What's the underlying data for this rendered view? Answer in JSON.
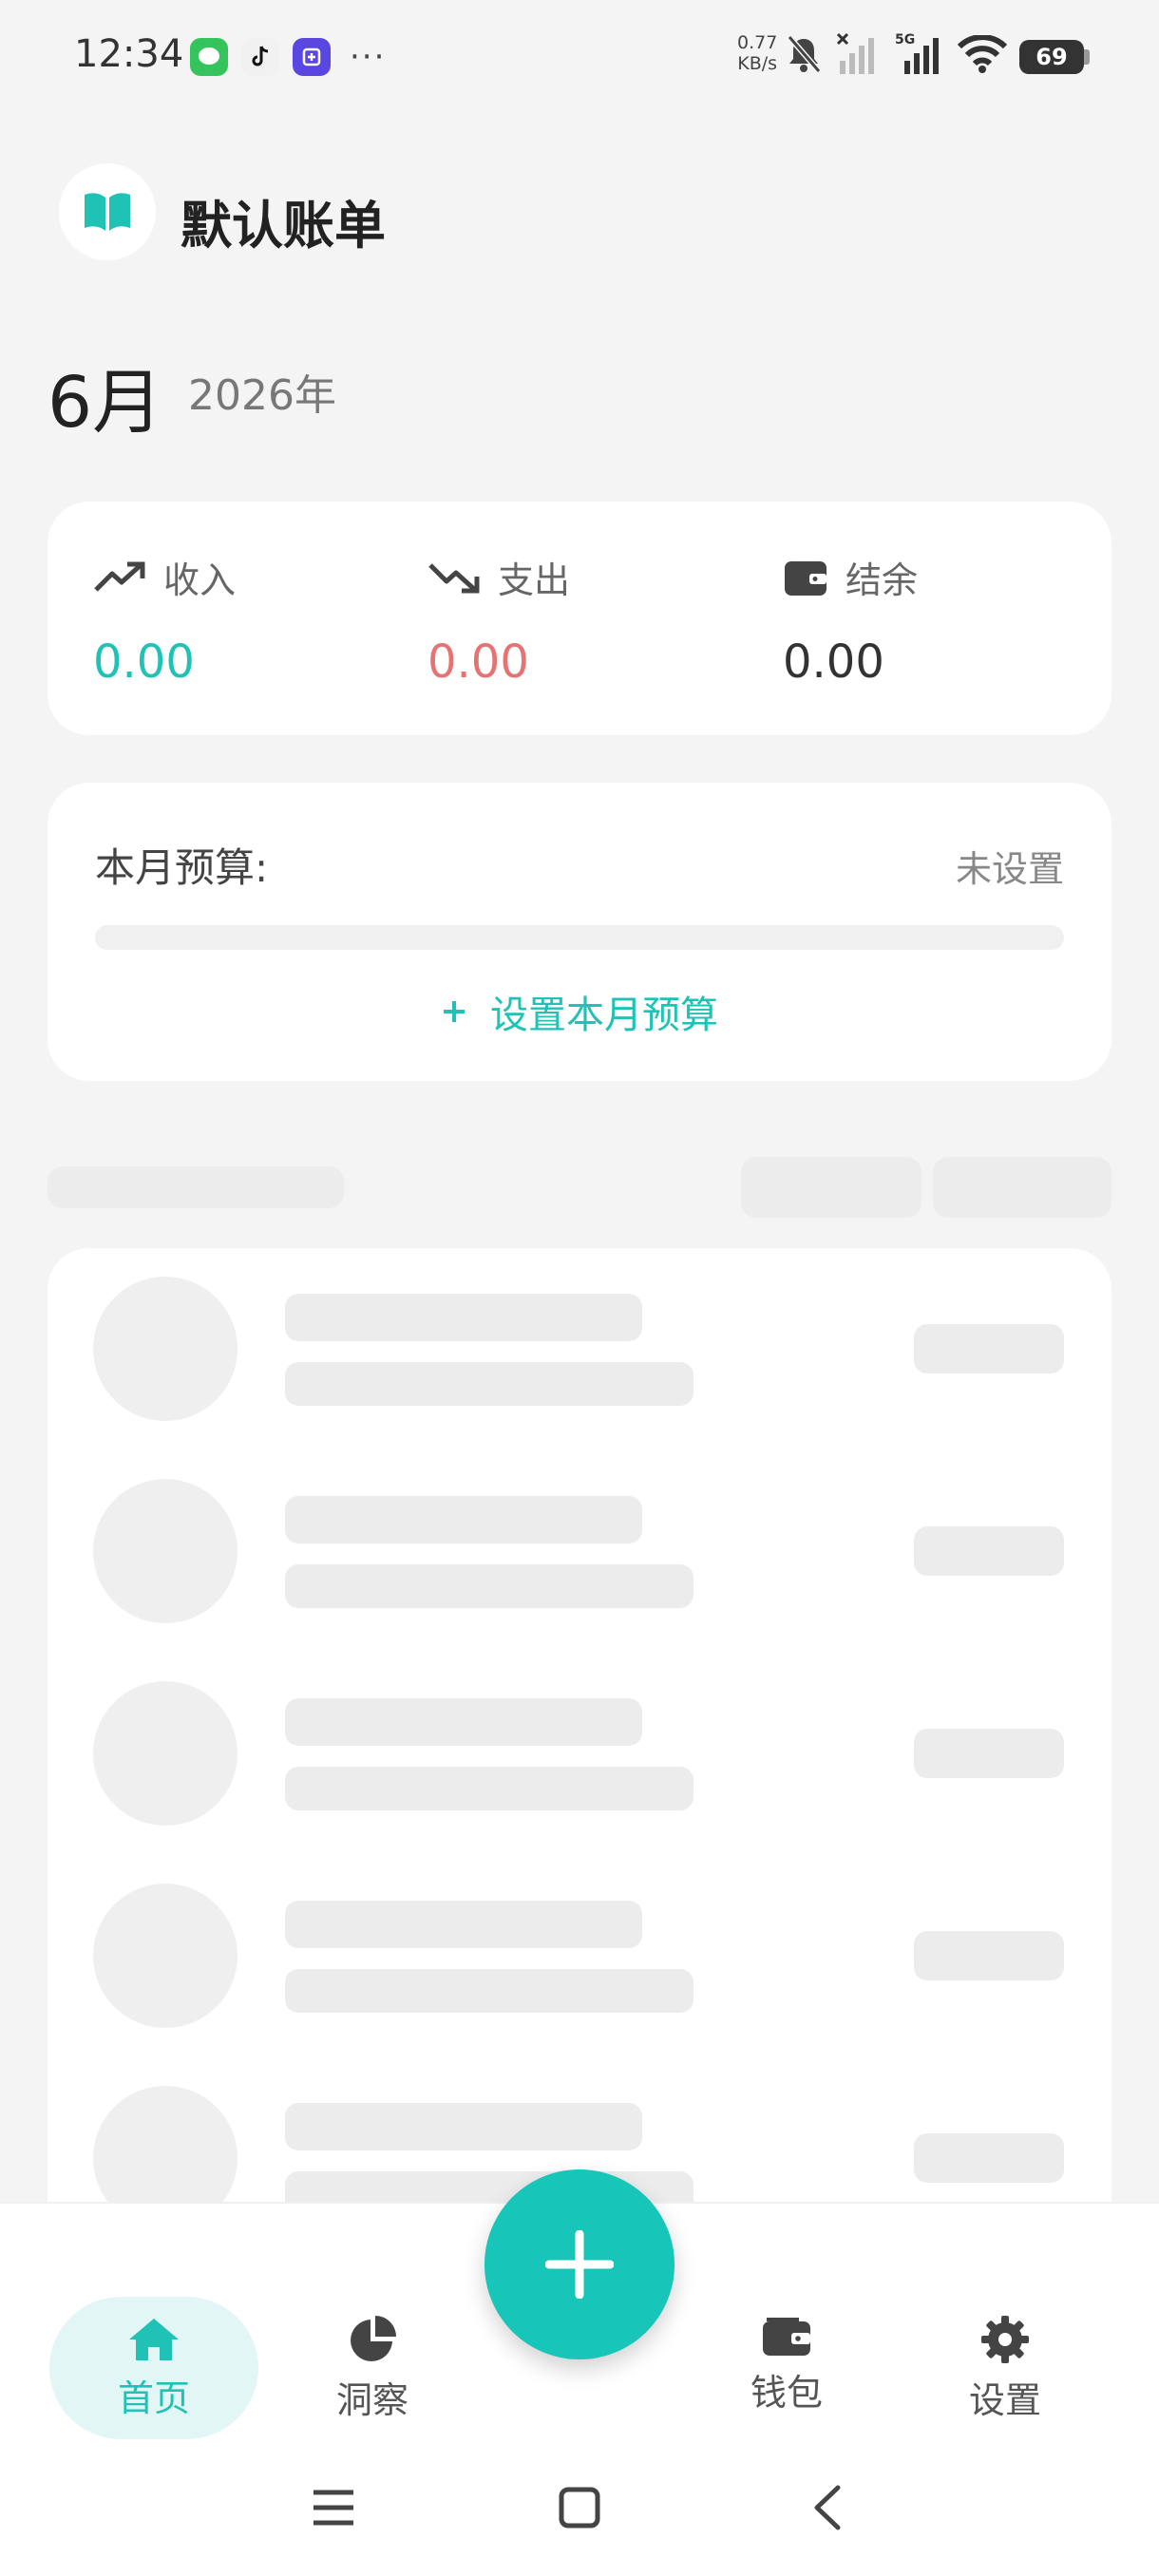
{
  "status_bar": {
    "time": "12:34",
    "app_icons": [
      "message-app-icon",
      "tiktok-icon",
      "tieba-icon"
    ],
    "more": "···",
    "net_speed_value": "0.77",
    "net_speed_unit": "KB/s",
    "network_type": "5G",
    "battery": "69"
  },
  "header": {
    "title": "默认账单",
    "icon": "book-icon"
  },
  "period": {
    "month": "6月",
    "year": "2026年"
  },
  "summary": {
    "income_label": "收入",
    "income_value": "0.00",
    "expense_label": "支出",
    "expense_value": "0.00",
    "balance_label": "结余",
    "balance_value": "0.00"
  },
  "budget": {
    "title": "本月预算:",
    "status": "未设置",
    "action_label": "设置本月预算",
    "progress": 0
  },
  "nav": {
    "items": [
      {
        "label": "首页",
        "icon": "home-icon",
        "active": true
      },
      {
        "label": "洞察",
        "icon": "pie-chart-icon",
        "active": false
      },
      {
        "label": "钱包",
        "icon": "wallet-icon",
        "active": false
      },
      {
        "label": "设置",
        "icon": "gear-icon",
        "active": false
      }
    ],
    "fab_icon": "plus-icon"
  },
  "colors": {
    "accent": "#1fc2b4",
    "expense": "#e57373",
    "background": "#f4f4f4"
  }
}
